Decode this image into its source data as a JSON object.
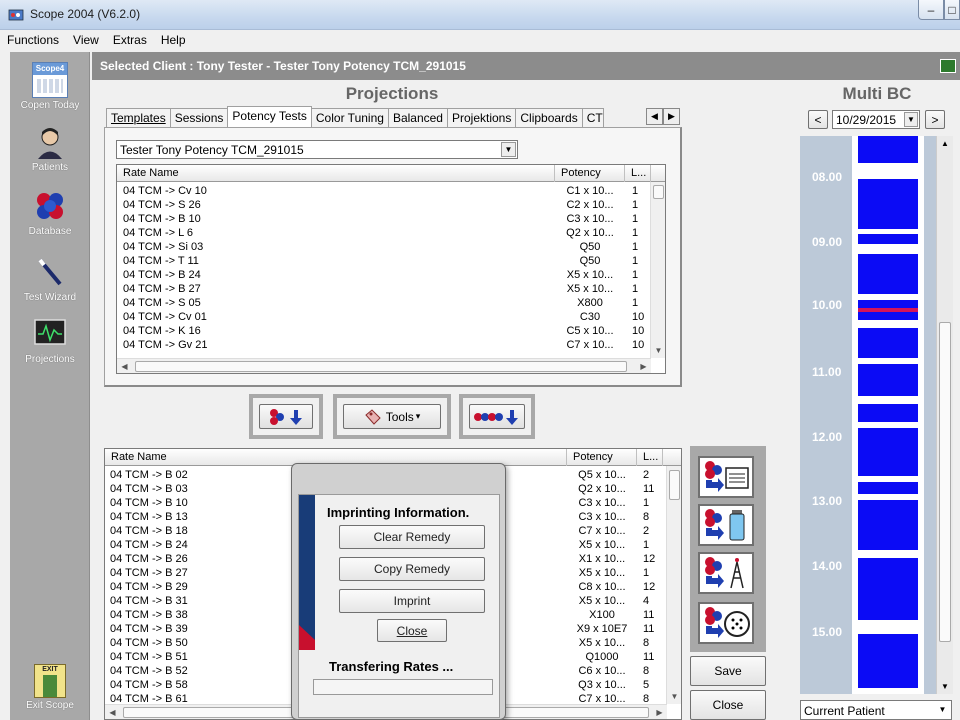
{
  "window": {
    "title": "Scope 2004 (V6.2.0)",
    "min_glyph": "–",
    "max_glyph": "□"
  },
  "menu": [
    "Functions",
    "View",
    "Extras",
    "Help"
  ],
  "sidebar": {
    "items": [
      {
        "label": "Copen Today",
        "icon": "calendar-icon",
        "badge": "Scope4"
      },
      {
        "label": "Patients",
        "icon": "person-icon"
      },
      {
        "label": "Database",
        "icon": "molecule-icon"
      },
      {
        "label": "Test Wizard",
        "icon": "wand-icon"
      },
      {
        "label": "Projections",
        "icon": "monitor-wave-icon"
      }
    ],
    "exit": {
      "label": "Exit Scope",
      "badge": "EXIT"
    }
  },
  "client": {
    "label": "Selected Client :  Tony Tester - Tester Tony Potency TCM_291015"
  },
  "projections": {
    "title": "Projections",
    "tabs": [
      {
        "label": "Templates",
        "active": false
      },
      {
        "label": "Sessions",
        "active": false
      },
      {
        "label": "Potency Tests",
        "active": true
      },
      {
        "label": "Color Tuning",
        "active": false
      },
      {
        "label": "Balanced",
        "active": false
      },
      {
        "label": "Projektions",
        "active": false
      },
      {
        "label": "Clipboards",
        "active": false
      },
      {
        "label": "CT",
        "active": false
      }
    ],
    "tab_scroll": {
      "left": "◀",
      "right": "▶"
    },
    "session_select": "Tester Tony Potency TCM_291015",
    "top_list": {
      "headers": [
        "Rate Name",
        "Potency",
        "L..."
      ],
      "rows": [
        [
          "04 TCM -> Cv 10",
          "C1 x 10...",
          "1"
        ],
        [
          "04 TCM -> S 26",
          "C2 x 10...",
          "1"
        ],
        [
          "04 TCM -> B 10",
          "C3 x 10...",
          "1"
        ],
        [
          "04 TCM -> L 6",
          "Q2 x 10...",
          "1"
        ],
        [
          "04 TCM -> Si 03",
          "Q50",
          "1"
        ],
        [
          "04 TCM -> T 11",
          "Q50",
          "1"
        ],
        [
          "04 TCM -> B 24",
          "X5 x 10...",
          "1"
        ],
        [
          "04 TCM -> B 27",
          "X5 x 10...",
          "1"
        ],
        [
          "04 TCM -> S 05",
          "X800",
          "1"
        ],
        [
          "04 TCM -> Cv 01",
          "C30",
          "10"
        ],
        [
          "04 TCM -> K 16",
          "C5 x 10...",
          "10"
        ],
        [
          "04 TCM -> Gv 21",
          "C7 x 10...",
          "10"
        ]
      ]
    }
  },
  "toolbar": {
    "tools_label": "Tools",
    "tools_arrow": "▾"
  },
  "bottom_list": {
    "headers": [
      "Rate Name",
      "Potency",
      "L..."
    ],
    "rows": [
      [
        "04 TCM -> B 02",
        "Q5 x 10...",
        "2"
      ],
      [
        "04 TCM -> B 03",
        "Q2 x 10...",
        "11"
      ],
      [
        "04 TCM -> B 10",
        "C3 x 10...",
        "1"
      ],
      [
        "04 TCM -> B 13",
        "C3 x 10...",
        "8"
      ],
      [
        "04 TCM -> B 18",
        "C7 x 10...",
        "2"
      ],
      [
        "04 TCM -> B 24",
        "X5 x 10...",
        "1"
      ],
      [
        "04 TCM -> B 26",
        "X1 x 10...",
        "12"
      ],
      [
        "04 TCM -> B 27",
        "X5 x 10...",
        "1"
      ],
      [
        "04 TCM -> B 29",
        "C8 x 10...",
        "12"
      ],
      [
        "04 TCM -> B 31",
        "X5 x 10...",
        "4"
      ],
      [
        "04 TCM -> B 38",
        "X100",
        "11"
      ],
      [
        "04 TCM -> B 39",
        "X9 x 10E7",
        "11"
      ],
      [
        "04 TCM -> B 50",
        "X5 x 10...",
        "8"
      ],
      [
        "04 TCM -> B 51",
        "Q1000",
        "11"
      ],
      [
        "04 TCM -> B 52",
        "C6 x 10...",
        "8"
      ],
      [
        "04 TCM -> B 58",
        "Q3 x 10...",
        "5"
      ],
      [
        "04 TCM -> B 61",
        "C7 x 10...",
        "8"
      ]
    ]
  },
  "actions": {
    "save": "Save",
    "close": "Close"
  },
  "multi_bc": {
    "title": "Multi BC",
    "date": "10/29/2015",
    "prev": "<",
    "next": ">",
    "hours": [
      "08.00",
      "09.00",
      "10.00",
      "11.00",
      "12.00",
      "13.00",
      "14.00",
      "15.00"
    ],
    "patient_select": "Current Patient"
  },
  "dialog": {
    "heading": "Imprinting Information.",
    "buttons": {
      "clear": "Clear Remedy",
      "copy": "Copy Remedy",
      "imprint": "Imprint",
      "close": "Close"
    },
    "status": "Transfering Rates ...",
    "progress": 0
  },
  "colors": {
    "timeline_bg": "#bcc9d8",
    "slot_blue": "#0b0bf5",
    "marker_red": "#d4145a",
    "sidebar_gray": "#a8a8a8",
    "client_strip": "#8c8c8c"
  },
  "glyphs": {
    "arrow_up": "▲",
    "arrow_down": "▼",
    "arrow_left": "◀",
    "arrow_right": "▶",
    "dropdown": "▼"
  }
}
